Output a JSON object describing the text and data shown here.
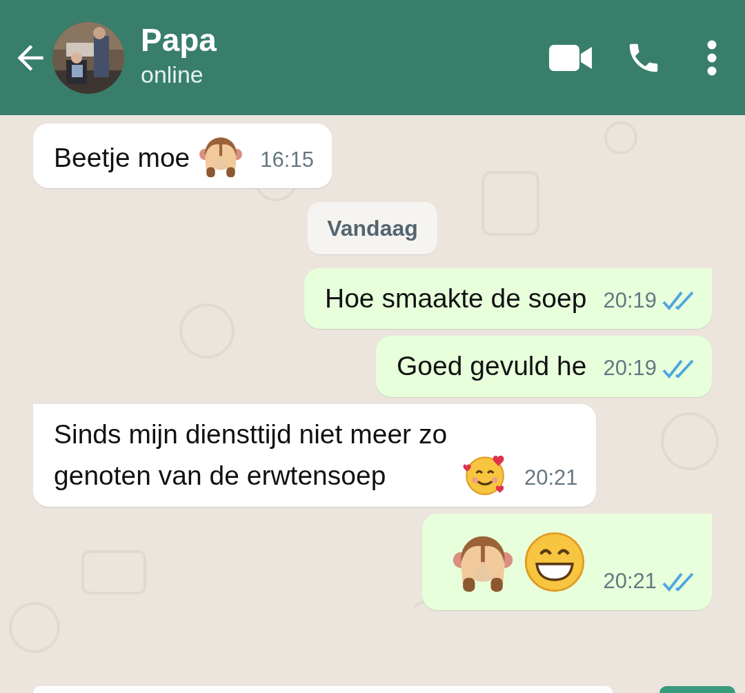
{
  "header": {
    "title": "Papa",
    "status": "online"
  },
  "messages": [
    {
      "kind": "in",
      "parts": [
        {
          "kind": "text",
          "text": "Beetje moe"
        },
        {
          "kind": "monkey"
        }
      ],
      "time": "16:15",
      "tail": false
    },
    {
      "kind": "date",
      "text": "Vandaag"
    },
    {
      "kind": "out",
      "parts": [
        {
          "kind": "text",
          "text": "Hoe smaakte de soep"
        }
      ],
      "time": "20:19",
      "read": true,
      "tail": true
    },
    {
      "kind": "out",
      "parts": [
        {
          "kind": "text",
          "text": "Goed gevuld he"
        }
      ],
      "time": "20:19",
      "read": true,
      "tail": false
    },
    {
      "kind": "in",
      "parts": [
        {
          "kind": "text",
          "text": "Sinds mijn diensttijd niet meer zo genoten van de erwtensoep"
        },
        {
          "kind": "hearts"
        }
      ],
      "time": "20:21",
      "tail": true
    },
    {
      "kind": "out",
      "parts": [
        {
          "kind": "monkey"
        },
        {
          "kind": "grin"
        }
      ],
      "time": "20:21",
      "read": true,
      "tail": true,
      "big": true
    }
  ]
}
